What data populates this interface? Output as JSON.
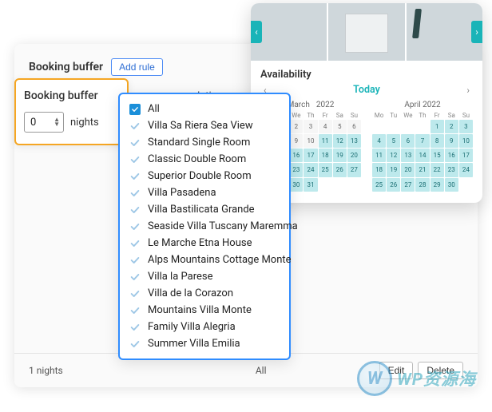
{
  "admin": {
    "title": "Booking buffer",
    "add_rule": "Add rule",
    "labels": {
      "nights": "nights",
      "accom": "modations",
      "avail": "Availability"
    },
    "footer": {
      "nights": "1 nights",
      "all": "All",
      "edit": "Edit",
      "delete": "Delete"
    }
  },
  "buffer_card": {
    "title": "Booking buffer",
    "value": "0",
    "unit": "nights"
  },
  "dropdown": {
    "all": "All",
    "items": [
      "Villa Sa Riera Sea View",
      "Standard Single Room",
      "Classic Double Room",
      "Superior Double Room",
      "Villa Pasadena",
      "Villa Bastilicata Grande",
      "Seaside Villa Tuscany Maremma",
      "Le Marche Etna House",
      "Alps Mountains Cottage Monte",
      "Villa la Parese",
      "Villa de la Corazon",
      "Mountains Villa Monte",
      "Family Villa Alegria",
      "Summer Villa Emilia"
    ]
  },
  "calendar": {
    "avail_title": "Availability",
    "today": "Today",
    "dow": [
      "Mo",
      "Tu",
      "We",
      "Th",
      "Fr",
      "Sa",
      "Su"
    ],
    "months": [
      {
        "name": "March",
        "year": "2022",
        "offset": 1,
        "days": 31,
        "avail_from": 11
      },
      {
        "name": "April 2022",
        "year": "",
        "offset": 4,
        "days": 30,
        "avail_from": 1
      }
    ]
  },
  "watermark": {
    "logo": "W",
    "text": "WP资源海"
  }
}
